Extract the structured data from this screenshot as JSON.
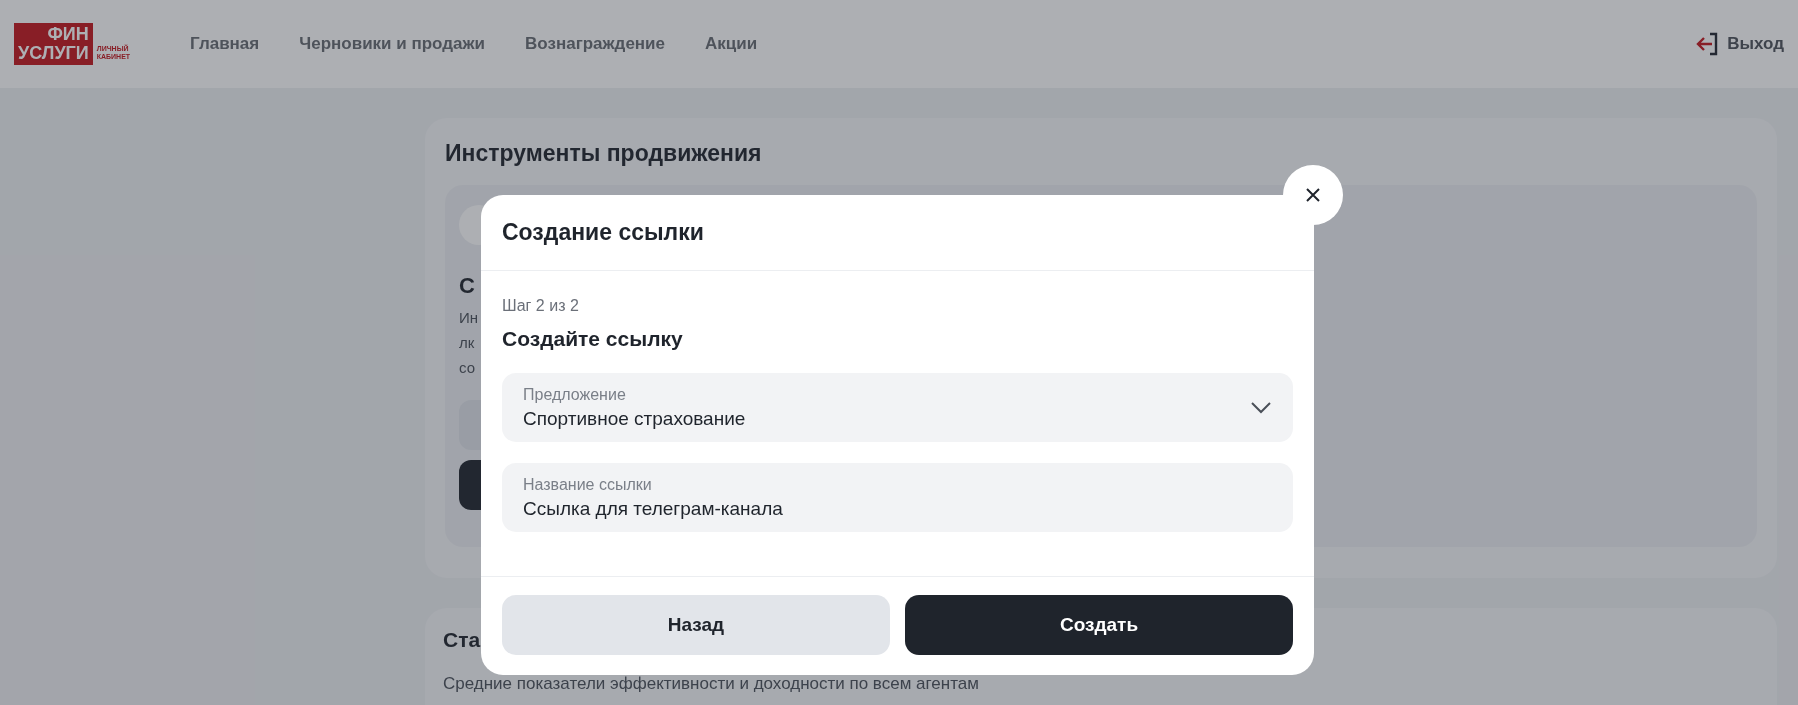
{
  "header": {
    "logo": {
      "line_1": "ФИН",
      "line_2": "УСЛУГИ",
      "caption_1": "ЛИЧНЫЙ",
      "caption_2": "КАБИНЕТ"
    },
    "nav": [
      {
        "label": "Главная"
      },
      {
        "label": "Черновики и продажи"
      },
      {
        "label": "Вознаграждение"
      },
      {
        "label": "Акции"
      }
    ],
    "logout": "Выход"
  },
  "page": {
    "tools_card": {
      "title": "Инструменты продвижения",
      "inner_card": {
        "title": "С",
        "text_lines": [
          "Ин",
          "лк",
          "со"
        ]
      }
    },
    "stats_card": {
      "title": "Ста",
      "subtitle": "Средние показатели эффективности и доходности по всем агентам"
    }
  },
  "modal": {
    "title": "Создание ссылки",
    "step": "Шаг 2 из 2",
    "heading": "Создайте ссылку",
    "fields": [
      {
        "kind": "select",
        "label": "Предложение",
        "value": "Спортивное страхование"
      },
      {
        "kind": "text",
        "label": "Название ссылки",
        "value": "Ссылка для телеграм-канала"
      }
    ],
    "buttons": [
      {
        "kind": "secondary",
        "label": "Назад"
      },
      {
        "kind": "primary",
        "label": "Создать"
      }
    ]
  }
}
